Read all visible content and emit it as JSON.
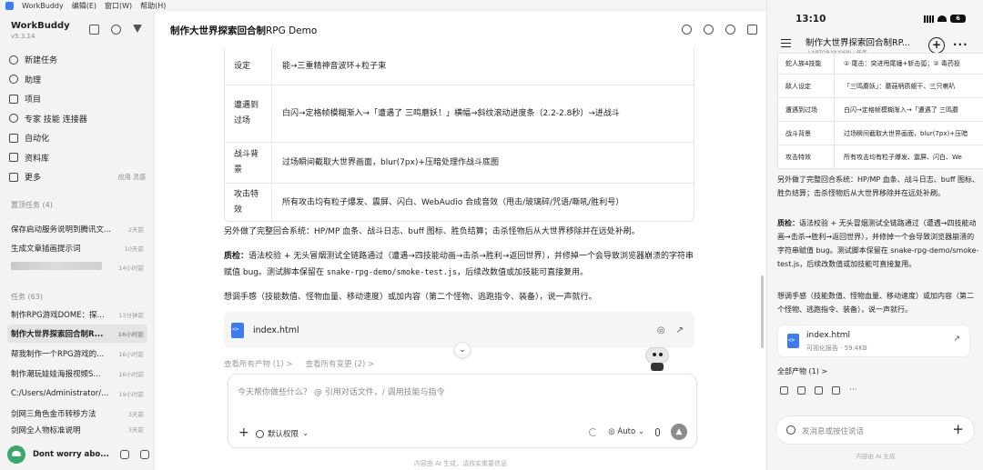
{
  "menubar": {
    "app": "WorkBuddy",
    "items": [
      "编辑(E)",
      "窗口(W)",
      "帮助(H)"
    ]
  },
  "sidebar": {
    "brand": "WorkBuddy",
    "version": "v5.3.14",
    "nav": [
      {
        "label": "新建任务",
        "extra": ""
      },
      {
        "label": "助理",
        "extra": ""
      },
      {
        "label": "项目",
        "extra": ""
      },
      {
        "label": "专家 技能 连接器",
        "extra": ""
      },
      {
        "label": "自动化",
        "extra": ""
      },
      {
        "label": "资料库",
        "extra": ""
      },
      {
        "label": "更多",
        "extra": "应用 灵感"
      }
    ],
    "pinned_title": "置顶任务 (4)",
    "pinned": [
      {
        "title": "保存启动服务说明到腾讯文...",
        "time": "2天前"
      },
      {
        "title": "生成文章插画提示词",
        "time": "10天前"
      },
      {
        "title": "",
        "time": "14小时前"
      }
    ],
    "tasks_title": "任务 (63)",
    "tasks": [
      {
        "title": "制作RPG游戏DOME：探...",
        "time": "13分钟前"
      },
      {
        "title": "制作大世界探索回合制R...",
        "time": "16小时前"
      },
      {
        "title": "帮我制作一个RPG游戏的...",
        "time": "16小时前"
      },
      {
        "title": "制作潮玩娃娃海报视频S...",
        "time": "16小时前"
      },
      {
        "title": "C:/Users/Administrator/...",
        "time": "19小时前"
      },
      {
        "title": "剑网三角色金币转移方法",
        "time": "3天前"
      },
      {
        "title": "剑网全人物标准说明",
        "time": "3天前"
      }
    ],
    "user": "Dont worry abo..."
  },
  "main": {
    "title_zh": "制作大世界探索回合制",
    "title_en": "RPG Demo",
    "table": [
      {
        "key": "设定",
        "value": "能→三重精神音波环+粒子束"
      },
      {
        "key": "遭遇到过场",
        "value": "白闪→定格帧模糊渐入→「遭遇了 三鸣蘑妖！」横幅→斜纹滚动进度条（2.2-2.8秒）→进战斗"
      },
      {
        "key": "战斗背景",
        "value": "过场瞬间截取大世界画面，blur(7px)+压暗处理作战斗底图"
      },
      {
        "key": "攻击特效",
        "value": "所有攻击均有粒子爆发、震屏、闪白、WebAudio 合成音效（甩击/玻璃碎/咒语/嘶吼/胜利号）"
      }
    ],
    "p1": "另外做了完整回合系统：HP/MP 血条、战斗日志、buff 图标、胜负结算；击杀怪物后从大世界移除并在远处补刷。",
    "p2_label": "质检：",
    "p2_text1": "语法校验 + 无头冒烟测试全链路通过（遭遇→四技能动画→击杀→胜利→返回世界），并修掉一个会导致浏览器崩溃的字符串赋值 bug。测试脚本保留在 ",
    "p2_code": "snake-rpg-demo/smoke-test.js",
    "p2_text2": "，后续改数值或加技能可直接复用。",
    "p3": "想调手感（技能数值、怪物血量、移动速度）或加内容（第二个怪物、逃跑指令、装备），说一声就行。",
    "file_name": "index.html",
    "link_outputs": "查看所有产物 (1) >",
    "link_changes": "查看所有变更 (2) >",
    "composer_placeholder": "今天帮你做些什么？ @ 引用对话文件，/ 调用技能与指令",
    "permission": "默认权限",
    "model": "Auto",
    "disclaimer": "内容由 AI 生成，请核实重要信息"
  },
  "phone": {
    "time": "13:10",
    "battery": "6",
    "title": "制作大世界探索回合制RP...",
    "subtitle": "LAPTOP-YAXJ68J · 任务",
    "table": [
      {
        "key": "蛇人族4技能",
        "value": "① 尾击：突进甩尾锤+斩击弧；② 毒药投"
      },
      {
        "key": "敌人设定",
        "value": "「三鸣蘑妖」：蘑菇柄质躯干、三只喇叭"
      },
      {
        "key": "遭遇到过场",
        "value": "白闪→定格帧模糊渐入→「遭遇了 三鸣蘑"
      },
      {
        "key": "战斗背景",
        "value": "过场瞬间截取大世界画面，blur(7px)+压暗"
      },
      {
        "key": "攻击特效",
        "value": "所有攻击均有粒子爆发、震屏、闪白、We"
      }
    ],
    "p1": "另外做了完整回合系统：HP/MP 血条、战斗日志、buff 图标、胜负结算；击杀怪物后从大世界移除并在远处补刷。",
    "p2_label": "质检：",
    "p2_text": "语法校验 + 无头冒烟测试全链路通过（遭遇→四技能动画→击杀→胜利→返回世界），并修掉一个会导致浏览器崩溃的字符串赋值 bug。测试脚本保留在 snake-rpg-demo/smoke-test.js，后续改数值或加技能可直接复用。",
    "p3": "想调手感（技能数值、怪物血量、移动速度）或加内容（第二个怪物、逃跑指令、装备），说一声就行。",
    "file_name": "index.html",
    "file_meta": "可视化报告 · 59.4KB",
    "all_outputs": "全部产物 (1) >",
    "input_placeholder": "发消息或按住说话",
    "footer": "内容由 AI 生成"
  }
}
